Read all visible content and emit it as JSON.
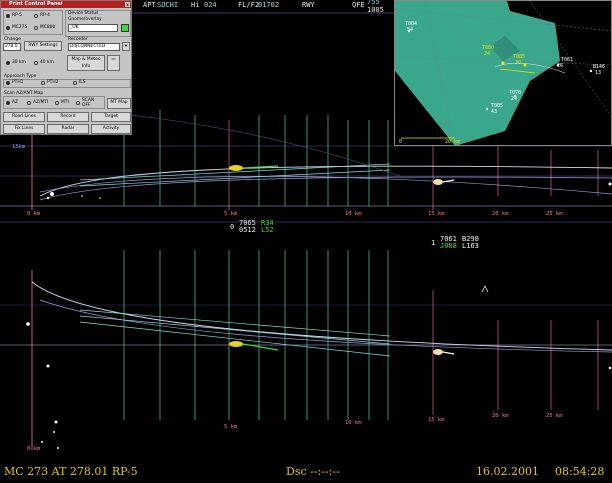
{
  "top_bar": {
    "apt": "APT",
    "apt_val": "SOCHI",
    "hi_label": "Hi",
    "hi_val": "024",
    "fl": "FL/F2",
    "fl_val": "01702",
    "rwy": "RWY",
    "qfe": "QFE",
    "qfe_val1": "755",
    "qfe_val2": "1005"
  },
  "control_panel": {
    "title": "Print Control Panel",
    "close": "x",
    "rp5": "RP-5",
    "rp4": "RP-4",
    "mc275": "MC275",
    "mc800": "MC800",
    "device_status_label": "Device Status",
    "gnome_label": "Gnome/overlay",
    "ok_value": "_OK",
    "change_label": "Change",
    "change_val": "278.0",
    "rwy_settings": "RWY Settings",
    "recorder_label": "Recorder",
    "recorder_val": "DISCONNECTED",
    "range_30": "30 km",
    "range_40": "40 km",
    "map_meteo": "Map & Meteo Info",
    "approach_type": "Approach Type",
    "pth1": "PTH1",
    "pth2": "PTH2",
    "ils": "ILS",
    "scan_label": "Scan AZ/ANT Map",
    "az": "AZ",
    "azmti": "AZ/MTI",
    "mti": "MTI",
    "scan_off": "SCAN OFF",
    "mt_map": "MT Map",
    "road_lines": "Road Lines",
    "record": "Record",
    "target": "Target",
    "fix_lines": "Fix Lines",
    "radar": "Radar",
    "activity": "Activity"
  },
  "inset_map": {
    "scale_start": "0",
    "scale_end": "20 km",
    "labels": [
      {
        "t": "T004",
        "c": "w"
      },
      {
        "t": "54",
        "c": "w"
      },
      {
        "t": "T080",
        "c": "y"
      },
      {
        "t": "24",
        "c": "y"
      },
      {
        "t": "T085",
        "c": "y"
      },
      {
        "t": "30",
        "c": "y"
      },
      {
        "t": "T061",
        "c": "w"
      },
      {
        "t": "26",
        "c": "w"
      },
      {
        "t": "B146",
        "c": "w"
      },
      {
        "t": "13",
        "c": "w"
      },
      {
        "t": "T070",
        "c": "w"
      },
      {
        "t": "24",
        "c": "w"
      },
      {
        "t": "T005",
        "c": "w"
      },
      {
        "t": "43",
        "c": "w"
      }
    ]
  },
  "upper_scope": {
    "alt_scale": "15km",
    "range_labels": [
      "0 km",
      "5 km",
      "10 km",
      "15 km",
      "20 km",
      "25 km"
    ],
    "tag_left": {
      "zero": "0",
      "l1a": "7065",
      "l1b": "R34",
      "l2a": "0512",
      "l2b": "L52"
    },
    "tag_right": {
      "one": "1",
      "l1a": "7061",
      "l1b": "B298",
      "l2a": "J088",
      "l2b": "L163"
    }
  },
  "lower_scope": {
    "range_labels": [
      "0 km",
      "5 km",
      "10 km",
      "15 km",
      "20 km",
      "25 km"
    ]
  },
  "status_bar": {
    "left": "MC 273 AT 278.01 RP-5",
    "center": "Dsc  --:--:--",
    "date": "16.02.2001",
    "time": "08:54:28"
  },
  "colors": {
    "track": "#3ddc3d",
    "range_text": "#ff6fb0",
    "inset_fill": "#3aa78d",
    "status_text": "#e6c800"
  }
}
